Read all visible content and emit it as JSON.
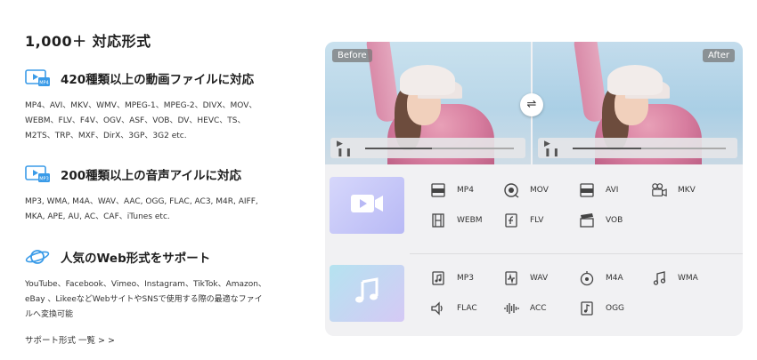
{
  "title": "1,000＋ 対応形式",
  "features": [
    {
      "icon": "video-file-icon",
      "title": "420種類以上の動画ファイルに対応",
      "lines": [
        "MP4、AVI、MKV、WMV、MPEG-1、MPEG-2、DIVX、MOV、",
        "WEBM、FLV、F4V、OGV、ASF、VOB、DV、HEVC、TS、",
        "M2TS、TRP、MXF、DirX、3GP、3G2 etc."
      ]
    },
    {
      "icon": "audio-file-icon",
      "title": "200種類以上の音声アイルに対応",
      "lines": [
        "MP3, WMA, M4A、WAV、AAC, OGG, FLAC, AC3, M4R, AIFF,",
        "MKA, APE, AU, AC、CAF、iTunes etc."
      ]
    },
    {
      "icon": "planet-icon",
      "title": "人気のWeb形式をサポート",
      "lines": [
        "YouTube、Facebook、Vimeo、Instagram、TikTok、Amazon、",
        "eBay 、LikeeなどWebサイトやSNSで使用する際の最適なファイ",
        "ルへ変換可能"
      ]
    }
  ],
  "more_link": "サポート形式 一覧 > >",
  "preview": {
    "before_label": "Before",
    "after_label": "After",
    "player_controls": "▶ ❚❚",
    "swap_icon": "⇌"
  },
  "video_formats": [
    "MP4",
    "MOV",
    "AVI",
    "MKV",
    "WEBM",
    "FLV",
    "VOB"
  ],
  "audio_formats": [
    "MP3",
    "WAV",
    "M4A",
    "WMA",
    "FLAC",
    "ACC",
    "OGG"
  ],
  "colors": {
    "accent_blue": "#3a9be8",
    "video_tile": "#c6c7f8",
    "audio_tile": "#c5d8f3"
  }
}
